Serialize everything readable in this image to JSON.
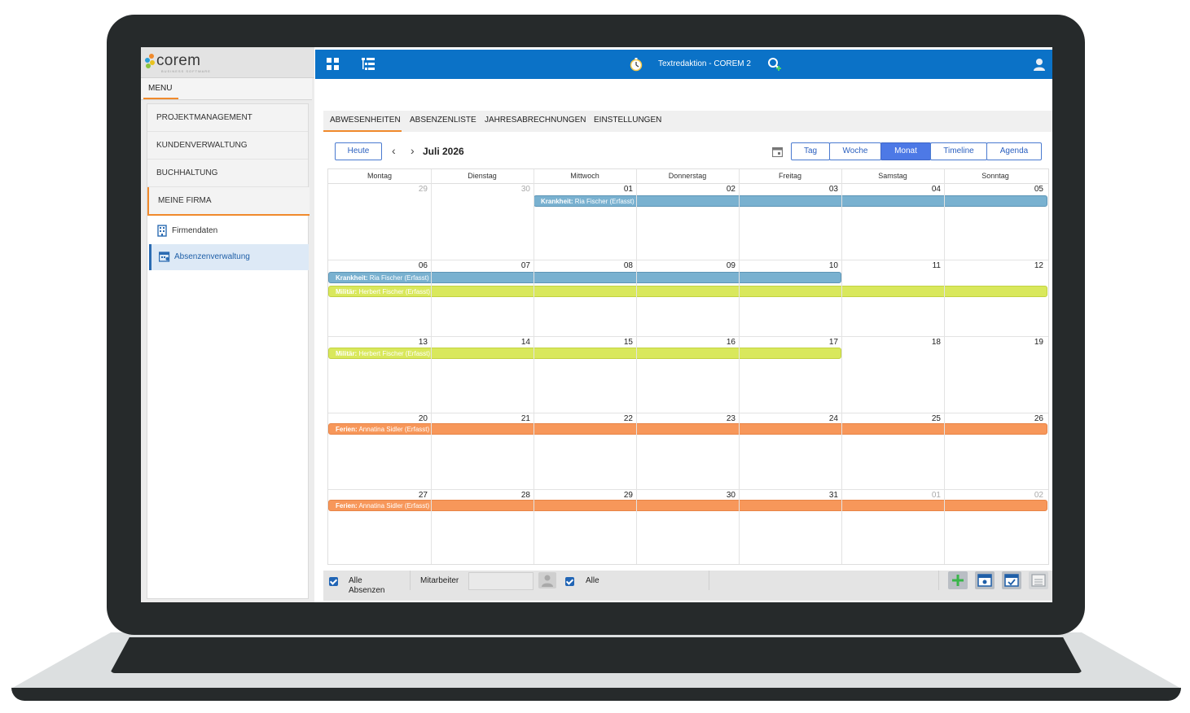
{
  "app": {
    "logo_text": "corem",
    "logo_sub": "BUSINESS SOFTWARE",
    "window_title": "Textredaktion - COREM 2"
  },
  "sidebar": {
    "menu_label": "MENU",
    "items": [
      {
        "label": "PROJEKTMANAGEMENT"
      },
      {
        "label": "KUNDENVERWALTUNG"
      },
      {
        "label": "BUCHHALTUNG"
      },
      {
        "label": "MEINE FIRMA"
      }
    ],
    "subitems": [
      {
        "label": "Firmendaten",
        "icon": "building-icon"
      },
      {
        "label": "Absenzenverwaltung",
        "icon": "calendar-person-icon"
      }
    ]
  },
  "tabs": [
    {
      "label": "ABWESENHEITEN"
    },
    {
      "label": "ABSENZENLISTE"
    },
    {
      "label": "JAHRESABRECHNUNGEN"
    },
    {
      "label": "EINSTELLUNGEN"
    }
  ],
  "toolbar": {
    "today": "Heute",
    "month_title": "Juli 2026",
    "views": [
      "Tag",
      "Woche",
      "Monat",
      "Timeline",
      "Agenda"
    ],
    "active_view": "Monat"
  },
  "calendar": {
    "weekdays": [
      "Montag",
      "Dienstag",
      "Mittwoch",
      "Donnerstag",
      "Freitag",
      "Samstag",
      "Sonntag"
    ],
    "weeks": [
      [
        "29",
        "30",
        "01",
        "02",
        "03",
        "04",
        "05"
      ],
      [
        "06",
        "07",
        "08",
        "09",
        "10",
        "11",
        "12"
      ],
      [
        "13",
        "14",
        "15",
        "16",
        "17",
        "18",
        "19"
      ],
      [
        "20",
        "21",
        "22",
        "23",
        "24",
        "25",
        "26"
      ],
      [
        "27",
        "28",
        "29",
        "30",
        "31",
        "01",
        "02"
      ]
    ],
    "events": [
      {
        "type": "Krankheit:",
        "text": " Ria Fischer (Erfasst)",
        "color": "#79b1d0"
      },
      {
        "type": "Krankheit:",
        "text": " Ria Fischer (Erfasst)",
        "color": "#79b1d0"
      },
      {
        "type": "Militär:",
        "text": " Herbert Fischer (Erfasst)",
        "color": "#d9e85c"
      },
      {
        "type": "Militär:",
        "text": " Herbert Fischer (Erfasst)",
        "color": "#d9e85c"
      },
      {
        "type": "Ferien:",
        "text": " Annatina Sidler (Erfasst)",
        "color": "#f7975a"
      },
      {
        "type": "Ferien:",
        "text": " Annatina Sidler (Erfasst)",
        "color": "#f7975a"
      }
    ]
  },
  "footer": {
    "all_absences_1": "Alle",
    "all_absences_2": "Absenzen",
    "employee_label": "Mitarbeiter",
    "all_label": "Alle"
  },
  "colors": {
    "topbar": "#0b72c7",
    "accent": "#f08a2c",
    "active_view": "#4d79e6"
  }
}
